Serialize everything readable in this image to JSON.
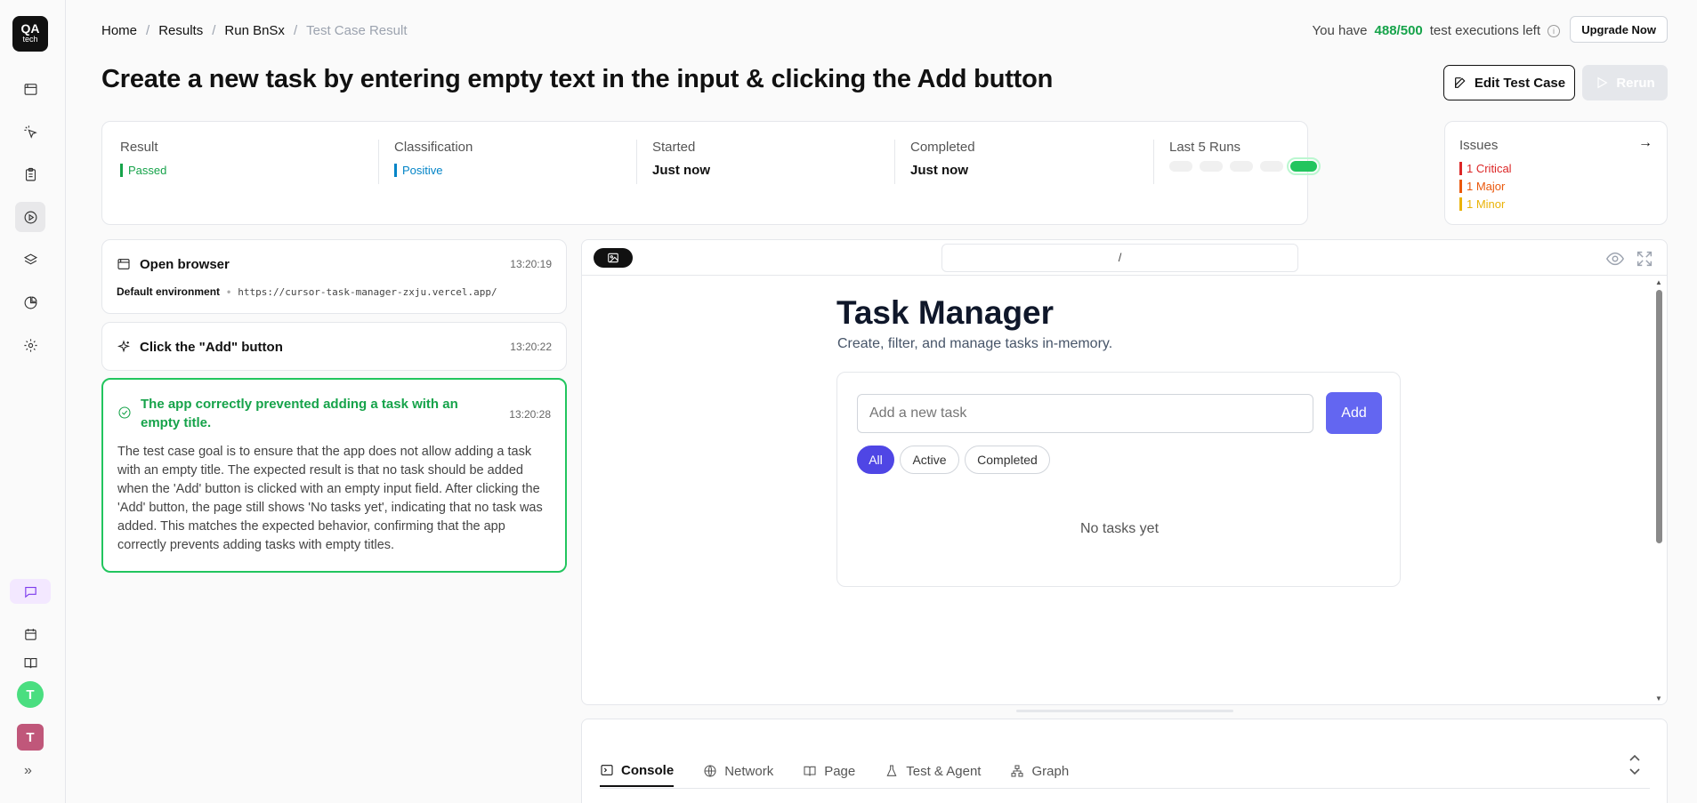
{
  "brand": {
    "logo_top": "QA",
    "logo_bottom": "tech"
  },
  "rail": {
    "items": [
      "calendar-window-icon",
      "cursor-click-icon",
      "clipboard-icon",
      "play-circle-icon",
      "layers-icon",
      "pie-chart-icon",
      "settings-icon"
    ],
    "bottom": [
      "chat-icon",
      "calendar-icon",
      "book-icon"
    ],
    "avatars": [
      {
        "letter": "T",
        "color": "#4ade80"
      },
      {
        "letter": "T",
        "color": "#c0577a"
      }
    ],
    "expand": "»"
  },
  "breadcrumb": {
    "items": [
      "Home",
      "Results",
      "Run BnSx"
    ],
    "current": "Test Case Result",
    "separator": "/"
  },
  "quota": {
    "prefix": "You have",
    "count": "488/500",
    "suffix": "test executions left"
  },
  "header": {
    "upgrade_label": "Upgrade Now",
    "title": "Create a new task by entering empty text in the input & clicking the Add button",
    "edit_label": "Edit Test Case",
    "rerun_label": "Rerun"
  },
  "summary": {
    "result": {
      "label": "Result",
      "value": "Passed"
    },
    "classification": {
      "label": "Classification",
      "value": "Positive"
    },
    "started": {
      "label": "Started",
      "value": "Just now"
    },
    "completed": {
      "label": "Completed",
      "value": "Just now"
    },
    "last_runs": {
      "label": "Last 5 Runs",
      "runs": [
        "none",
        "none",
        "none",
        "none",
        "passed"
      ]
    }
  },
  "issues": {
    "label": "Issues",
    "items": [
      {
        "text": "1 Critical",
        "color": "#dc2626"
      },
      {
        "text": "1 Major",
        "color": "#ea580c"
      },
      {
        "text": "1 Minor",
        "color": "#eab308"
      }
    ]
  },
  "steps": [
    {
      "title": "Open browser",
      "time": "13:20:19",
      "env_label": "Default environment",
      "env_sep": "•",
      "url": "https://cursor-task-manager-zxju.vercel.app/"
    },
    {
      "title": "Click the \"Add\" button",
      "time": "13:20:22"
    },
    {
      "title": "The app correctly prevented adding a task with an empty title.",
      "time": "13:20:28",
      "body": "The test case goal is to ensure that the app does not allow adding a task with an empty title. The expected result is that no task should be added when the 'Add' button is clicked with an empty input field. After clicking the 'Add' button, the page still shows 'No tasks yet', indicating that no task was added. This matches the expected behavior, confirming that the app correctly prevents adding tasks with empty titles."
    }
  ],
  "browser": {
    "address": "/",
    "app": {
      "title": "Task Manager",
      "subtitle": "Create, filter, and manage tasks in-memory.",
      "input_placeholder": "Add a new task",
      "add_label": "Add",
      "filters": [
        "All",
        "Active",
        "Completed"
      ],
      "active_filter": "All",
      "empty_text": "No tasks yet"
    }
  },
  "devtools": {
    "tabs": [
      "Console",
      "Network",
      "Page",
      "Test & Agent",
      "Graph"
    ],
    "active_tab": "Console"
  }
}
